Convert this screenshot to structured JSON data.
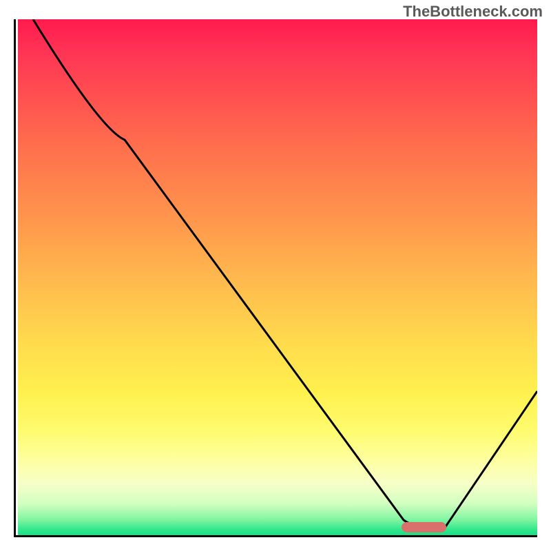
{
  "watermark": "TheBottleneck.com",
  "chart_data": {
    "type": "line",
    "title": "",
    "xlabel": "",
    "ylabel": "",
    "x_range": [
      0,
      100
    ],
    "y_range": [
      0,
      100
    ],
    "series": [
      {
        "name": "curve",
        "points": [
          {
            "x": 3,
            "y": 100
          },
          {
            "x": 20,
            "y": 77
          },
          {
            "x": 74,
            "y": 3
          },
          {
            "x": 80,
            "y": 1.5
          },
          {
            "x": 82,
            "y": 1.5
          },
          {
            "x": 100,
            "y": 28
          }
        ]
      }
    ],
    "marker": {
      "x_start": 74,
      "x_end": 82,
      "y": 1.5
    },
    "background": "heat-gradient"
  }
}
